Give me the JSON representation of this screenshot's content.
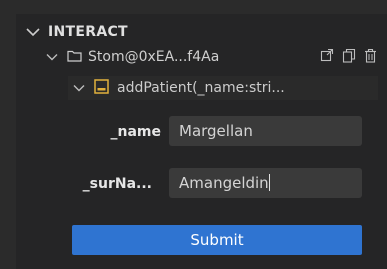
{
  "section": {
    "title": "INTERACT"
  },
  "contract": {
    "name": "Stom@0xEA...f4Aa"
  },
  "method": {
    "signature": "addPatient(_name:stri..."
  },
  "fields": [
    {
      "label": "_name",
      "value": "Margellan"
    },
    {
      "label": "_surNa...",
      "value": "Amangeldin"
    }
  ],
  "submit": {
    "label": "Submit"
  },
  "colors": {
    "accent": "#2f74d1",
    "method_icon": "#e2b13c",
    "panel": "#252526",
    "input": "#3a3a3a"
  },
  "icons": [
    "chevron-down-icon",
    "folder-icon",
    "open-in-editor-icon",
    "copy-icon",
    "trash-icon",
    "method-icon"
  ]
}
